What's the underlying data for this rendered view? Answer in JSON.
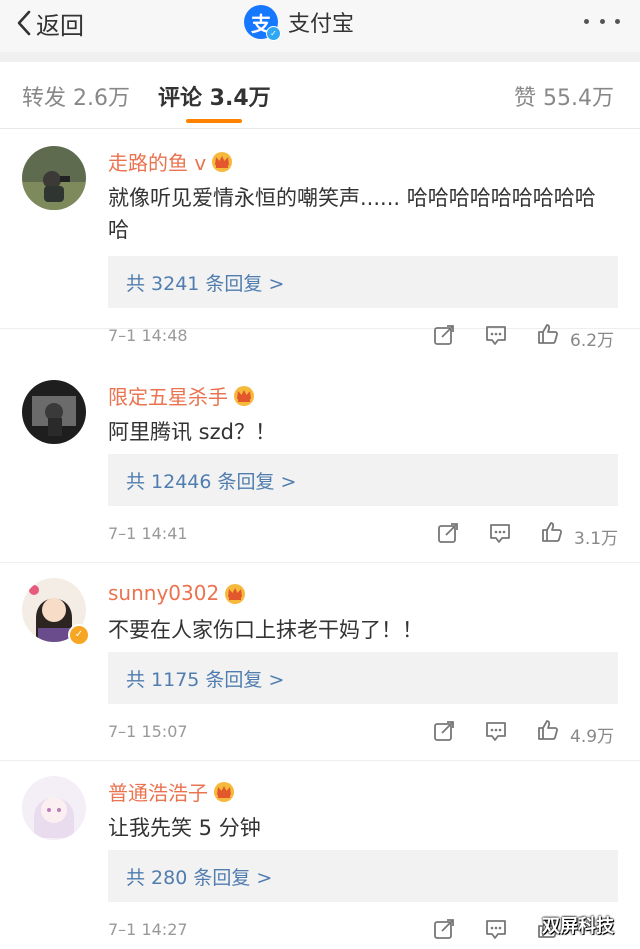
{
  "nav": {
    "back_label": "返回",
    "title": "支付宝",
    "logo_glyph": "支"
  },
  "tabs": {
    "repost": "转发 2.6万",
    "comments": "评论 3.4万",
    "likes": "赞 55.4万"
  },
  "comments": [
    {
      "username": "走路的鱼 v",
      "text": "就像听见爱情永恒的嘲笑声...... 哈哈哈哈哈哈哈哈哈哈",
      "replies": "共 3241 条回复 >",
      "time": "7–1 14:48",
      "likes": "6.2万"
    },
    {
      "username": "限定五星杀手",
      "text": "阿里腾讯 szd？！",
      "replies": "共 12446 条回复 >",
      "time": "7–1 14:41",
      "likes": "3.1万"
    },
    {
      "username": "sunny0302",
      "text": "不要在人家伤口上抹老干妈了！！",
      "replies": "共 1175 条回复 >",
      "time": "7–1 15:07",
      "likes": "4.9万"
    },
    {
      "username": "普通浩浩子",
      "text": "让我先笑 5 分钟",
      "replies": "共 280 条回复 >",
      "time": "7–1 14:27",
      "likes": ""
    }
  ],
  "watermark": "双屏科技",
  "colors": {
    "accent": "#ff8200",
    "username": "#eb7350",
    "reply_link": "#507daf",
    "alipay_blue": "#1677ff"
  },
  "icons": [
    "back-chevron-icon",
    "alipay-logo-icon",
    "more-dots-icon",
    "crown-badge-icon",
    "repost-icon",
    "comment-icon",
    "like-thumb-icon"
  ]
}
